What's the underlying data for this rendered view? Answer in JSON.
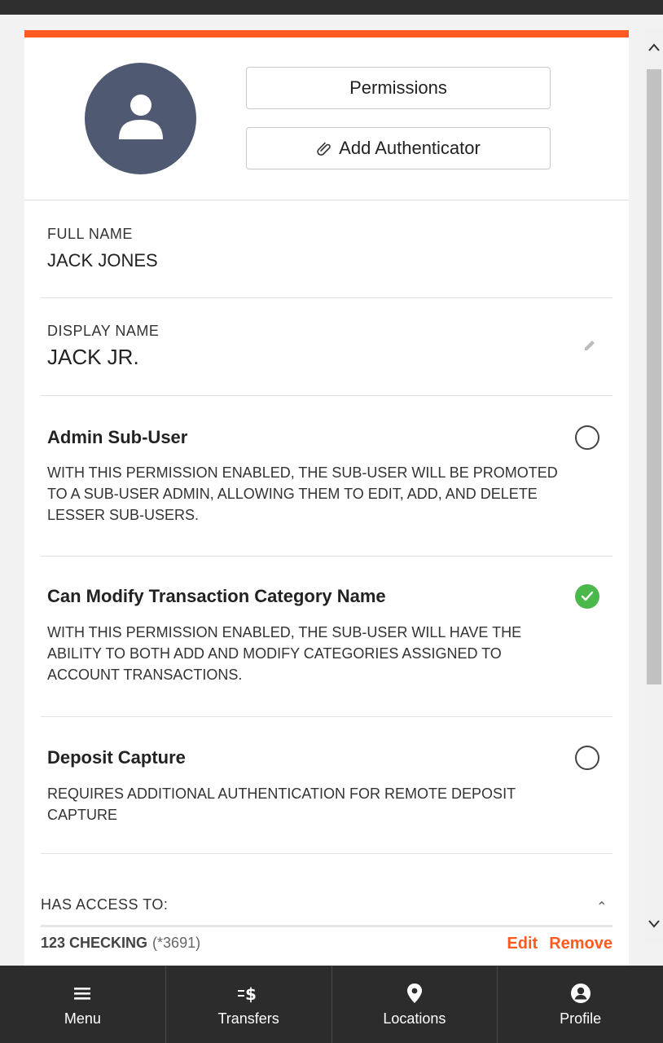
{
  "header": {
    "permissions_label": "Permissions",
    "add_authenticator_label": "Add Authenticator"
  },
  "full_name": {
    "label": "FULL NAME",
    "value": "JACK JONES"
  },
  "display_name": {
    "label": "DISPLAY NAME",
    "value": "JACK JR."
  },
  "permissions": [
    {
      "title": "Admin Sub-User",
      "description": "WITH THIS PERMISSION ENABLED, THE SUB-USER WILL BE PROMOTED TO A SUB-USER ADMIN, ALLOWING THEM TO EDIT, ADD, AND DELETE LESSER SUB-USERS.",
      "checked": false
    },
    {
      "title": "Can Modify Transaction Category Name",
      "description": "WITH THIS PERMISSION ENABLED, THE SUB-USER WILL HAVE THE ABILITY TO BOTH ADD AND MODIFY CATEGORIES ASSIGNED TO ACCOUNT TRANSACTIONS.",
      "checked": true
    },
    {
      "title": "Deposit Capture",
      "description": "REQUIRES ADDITIONAL AUTHENTICATION FOR REMOTE DEPOSIT CAPTURE",
      "checked": false
    }
  ],
  "access": {
    "label": "HAS ACCESS TO:",
    "accounts": [
      {
        "name": "123 CHECKING",
        "mask": "(*3691)",
        "edit_label": "Edit",
        "remove_label": "Remove"
      }
    ]
  },
  "bottom_nav": [
    {
      "label": "Menu",
      "icon": "hamburger-menu-icon"
    },
    {
      "label": "Transfers",
      "icon": "transfer-dollar-icon"
    },
    {
      "label": "Locations",
      "icon": "map-pin-icon"
    },
    {
      "label": "Profile",
      "icon": "user-circle-icon"
    }
  ],
  "colors": {
    "accent": "#ff5a1f",
    "avatar_bg": "#4f5a72",
    "checked_green": "#4bb84b",
    "nav_bg": "#2c2c2c"
  }
}
